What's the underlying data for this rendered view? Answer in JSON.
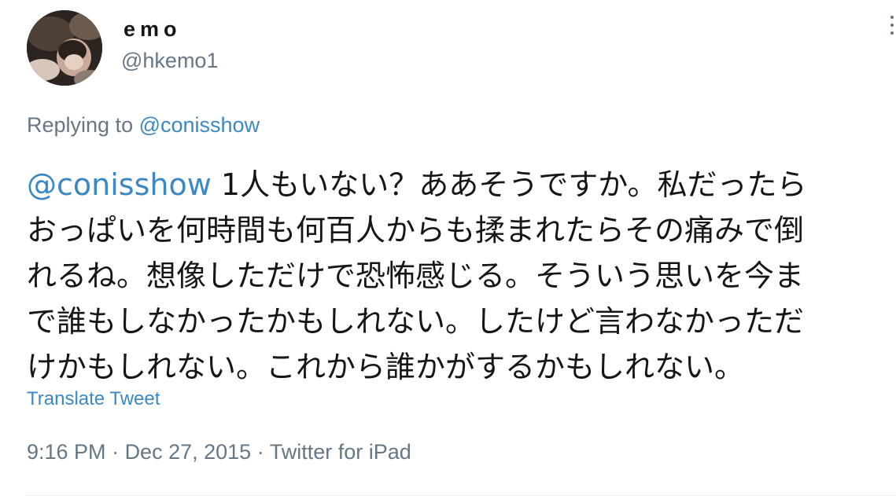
{
  "user": {
    "display_name": "emo",
    "handle": "@hkemo1"
  },
  "reply": {
    "prefix": "Replying to ",
    "mention": "@conisshow"
  },
  "tweet": {
    "mention": "@conisshow",
    "lines": [
      "1人もいない？ああそうですか。私だったら",
      "おっぱいを何時間も何百人からも揉まれたらその痛みで倒",
      "れるね。想像しただけで恐怖感じる。そういう思いを今ま",
      "で誰もしなかったかもしれない。したけど言わなかっただ",
      "けかもしれない。これから誰かがするかもしれない。"
    ]
  },
  "translate_label": "Translate Tweet",
  "meta": {
    "time": "9:16 PM",
    "separator": " · ",
    "date": "Dec 27, 2015",
    "source": "Twitter for iPad"
  },
  "colors": {
    "link": "#3b88c3",
    "muted": "#657786",
    "text": "#14171a"
  },
  "icons": {
    "more": "more-dots-icon",
    "avatar": "avatar-photo"
  }
}
